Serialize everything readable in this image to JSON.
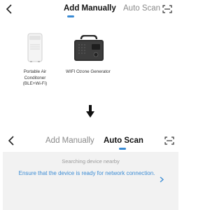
{
  "top_header": {
    "tabs": [
      {
        "label": "Add Manually",
        "active": true
      },
      {
        "label": "Auto Scan",
        "active": false
      }
    ],
    "icons": {
      "back": "chevron-left-icon",
      "scan": "scan-icon"
    }
  },
  "devices": [
    {
      "label": "Portable Air Conditoner (BLE+Wi-Fi)",
      "icon": "portable-air-conditioner-image"
    },
    {
      "label": "WIFI Ozone Generator",
      "icon": "ozone-generator-image"
    }
  ],
  "arrow_icon": "arrow-down-icon",
  "bottom_header": {
    "tabs": [
      {
        "label": "Add Manually",
        "active": false
      },
      {
        "label": "Auto Scan",
        "active": true
      }
    ],
    "icons": {
      "back": "chevron-left-icon",
      "scan": "scan-icon"
    }
  },
  "scan_panel": {
    "status": "Searching device nearby",
    "message": "Ensure that the device is ready for network connection.",
    "chevron_icon": "chevron-right-icon"
  },
  "colors": {
    "accent": "#3a8bd4",
    "panel_bg": "#f2f2f2",
    "active_text": "#111111",
    "inactive_text": "#8a8a8a"
  }
}
